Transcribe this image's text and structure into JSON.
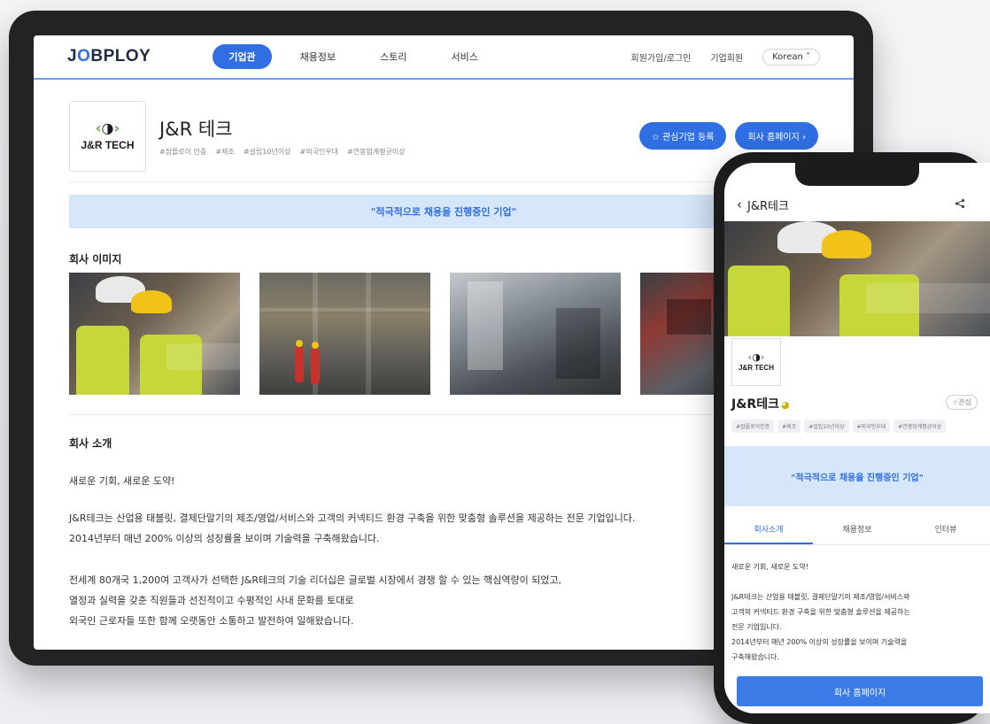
{
  "tablet": {
    "logo": {
      "part1": "J",
      "part2": "O",
      "part3": "BPLOY"
    },
    "nav": [
      "기업관",
      "채용정보",
      "스토리",
      "서비스"
    ],
    "header_right": {
      "login": "회원가입/로그인",
      "corp": "기업회원",
      "lang": "Korean ˅"
    },
    "company": {
      "logo_text": "J&R TECH",
      "name": "J&R 테크",
      "tags": [
        "#잡플로이 인증",
        "#제조",
        "#설립10년이상",
        "#외국인우대",
        "#연봉업계평균이상"
      ],
      "fav_button": "☆ 관심기업 등록",
      "home_button": "회사 홈페이지 ›"
    },
    "banner": "\"적극적으로 채용을 진행중인 기업\"",
    "images_title": "회사 이미지",
    "intro_title": "회사 소개",
    "intro": {
      "line1": "새로운 기회, 새로운 도약!",
      "line2": "J&R테크는 산업용 태블릿, 결제단말기의 제조/영업/서비스와 고객의 커넥티드 환경 구축을 위한 맞춤형 솔루션을 제공하는 전문 기업입니다.",
      "line3": "2014년부터 매년 200% 이상의 성장률을 보이며 기술력을 구축해왔습니다.",
      "line4": "전세계 80개국 1,200여 고객사가 선택한 J&R테크의 기술 리더십은 글로벌 시장에서 경쟁 할 수 있는 핵심역량이 되었고,",
      "line5": "열정과 실력을 갖춘 직원들과 선진적이고 수평적인 사내 문화를 토대로",
      "line6": "외국인 근로자들 또한 함께 오랫동안 소통하고 발전하여 일해왔습니다."
    }
  },
  "phone": {
    "back": "‹",
    "title": "J&R테크",
    "share": "<",
    "logo_text": "J&R TECH",
    "name": "J&R테크",
    "fav": "☆관심",
    "tags": [
      "#잡플로이인증",
      "#제조",
      "#설립10년이상",
      "#외국인우대",
      "#연봉업계평균이상"
    ],
    "banner": "\"적극적으로 채용을 진행중인 기업\"",
    "tabs": [
      "회사소개",
      "채용정보",
      "인터뷰"
    ],
    "intro": {
      "line1": "새로운 기회, 새로운 도약!",
      "line2": "J&R테크는 산업용 태블릿, 결제단말기의 제조/영업/서비스와",
      "line3": "고객의 커넥티드 환경 구축을 위한 맞춤형 솔루션을 제공하는",
      "line4": "전문 기업입니다.",
      "line5": "2014년부터 매년 200% 이상의 성장률을 보이며 기술력을",
      "line6": "구축해왔습니다."
    },
    "cta": "회사 홈페이지"
  }
}
